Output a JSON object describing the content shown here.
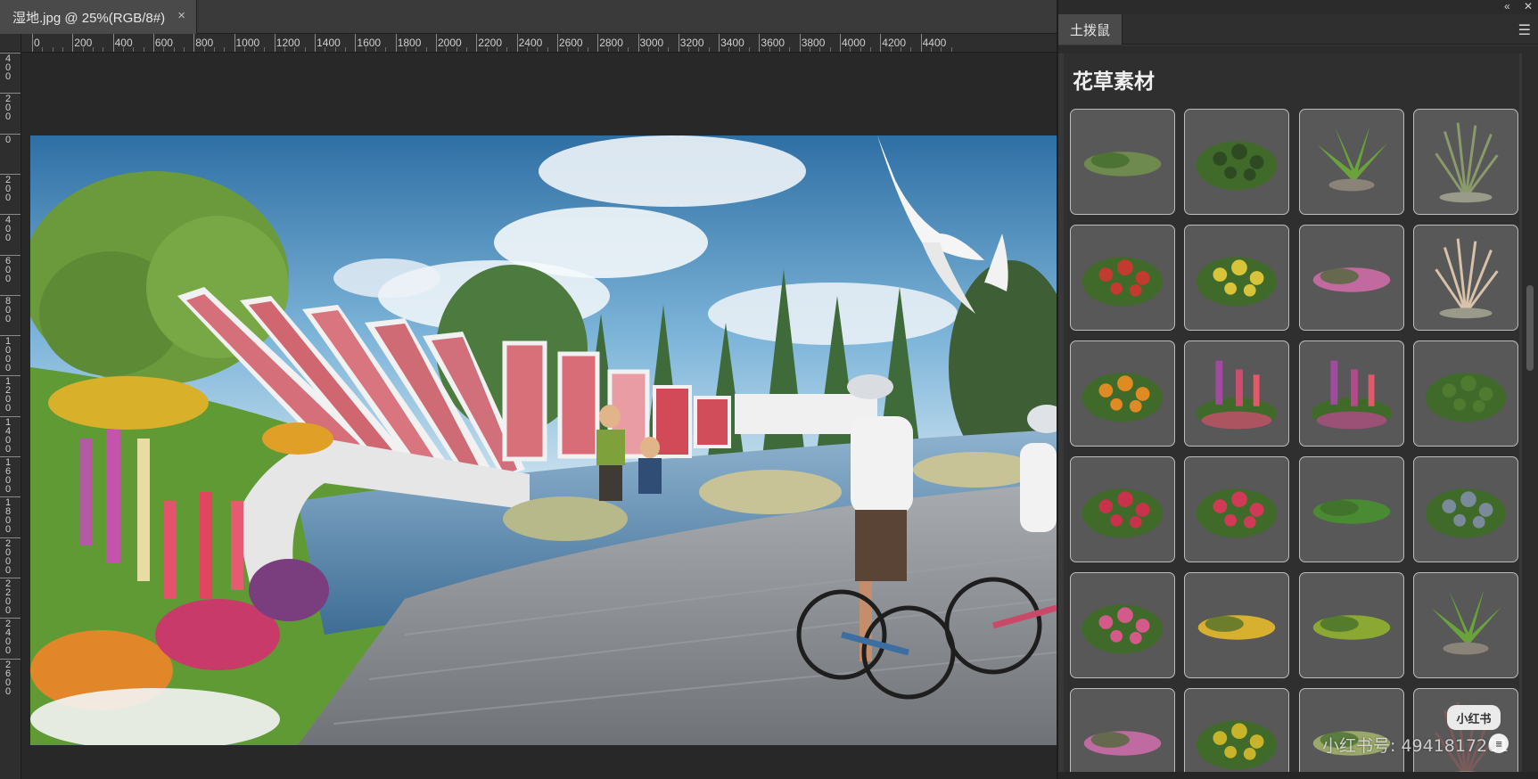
{
  "document": {
    "tab_title": "湿地.jpg @ 25%(RGB/8#)",
    "close_glyph": "×",
    "ruler_h_labels": [
      "0",
      "200",
      "400",
      "600",
      "800",
      "1000",
      "1200",
      "1400",
      "1600",
      "1800",
      "2000",
      "2200",
      "2400",
      "2600",
      "2800",
      "3000",
      "3200",
      "3400",
      "3600",
      "3800",
      "4000",
      "4200",
      "4400"
    ],
    "ruler_v_labels": [
      "400",
      "200",
      "0",
      "200",
      "400",
      "600",
      "800",
      "1000",
      "1200",
      "1400",
      "1600",
      "1800",
      "2000",
      "2200",
      "2400",
      "2600"
    ]
  },
  "panel": {
    "collapse_glyph": "«",
    "close_glyph": "✕",
    "tab_label": "土拨鼠",
    "menu_icon": "hamburger-icon",
    "title": "花草素材",
    "assets": [
      {
        "kind": "groundcover"
      },
      {
        "kind": "shrub"
      },
      {
        "kind": "fern"
      },
      {
        "kind": "grass-tall"
      },
      {
        "kind": "red-flowers"
      },
      {
        "kind": "yellow-purple-flowers"
      },
      {
        "kind": "pink-flowers-low"
      },
      {
        "kind": "pampas"
      },
      {
        "kind": "orange-flowers"
      },
      {
        "kind": "lupine-mix"
      },
      {
        "kind": "lupine-mix-2"
      },
      {
        "kind": "green-shrub"
      },
      {
        "kind": "red-flower-bed"
      },
      {
        "kind": "red-pink-flowers"
      },
      {
        "kind": "green-low"
      },
      {
        "kind": "mixed-flowers"
      },
      {
        "kind": "pink-peony"
      },
      {
        "kind": "yellow-low"
      },
      {
        "kind": "green-grass"
      },
      {
        "kind": "fern-2"
      },
      {
        "kind": "pink-low"
      },
      {
        "kind": "yellow-shrub"
      },
      {
        "kind": "grass-low"
      },
      {
        "kind": "tall-plant"
      }
    ],
    "colors": {
      "panel_bg": "#383838",
      "tile_bg": "#585858",
      "tile_border": "#bdbdbd"
    }
  },
  "watermark": {
    "badge": "小红书",
    "text": "小红书号: 4941817201"
  }
}
